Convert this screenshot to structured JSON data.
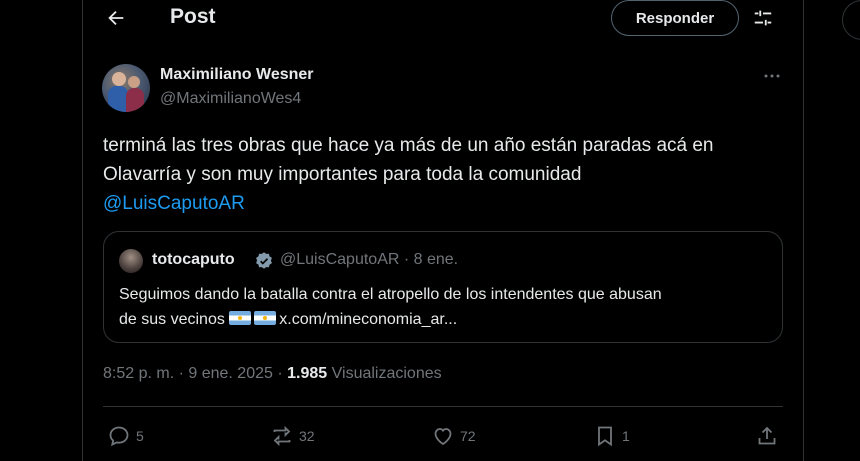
{
  "header": {
    "title": "Post",
    "reply_button_label": "Responder"
  },
  "post": {
    "author_name": "Maximiliano Wesner",
    "author_handle": "@MaximilianoWes4",
    "text_line_1": "terminá las tres obras que hace ya más de un año están paradas acá en",
    "text_line_2": "Olavarría y son muy importantes para toda la comunidad",
    "mention": "@LuisCaputoAR",
    "time": "8:52 p. m. · 9 ene. 2025 ·",
    "views_count": "1.985",
    "views_label": "Visualizaciones"
  },
  "quote": {
    "name": "totocaputo",
    "meta": "@LuisCaputoAR · 8 ene.",
    "text_line_1": "Seguimos dando la batalla contra el atropello de los intendentes que abusan",
    "text_line_2_prefix": "de sus vecinos",
    "link": "x.com/mineconomia_ar..."
  },
  "actions": {
    "replies": "5",
    "reposts": "32",
    "likes": "72",
    "bookmarks": "1"
  },
  "colors": {
    "background": "#000000",
    "text": "#e7e9ea",
    "secondary_text": "#71767b",
    "border": "#2f3336",
    "accent": "#1d9bf0"
  }
}
